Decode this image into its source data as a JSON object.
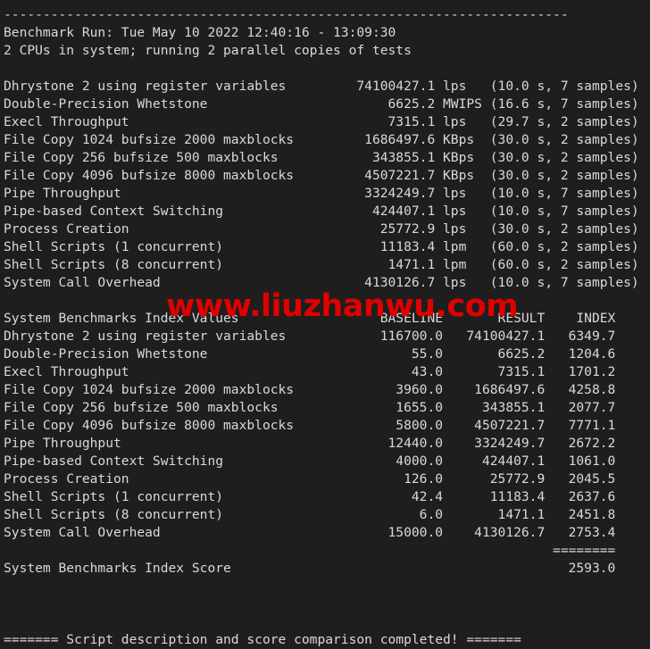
{
  "terminal": {
    "background_color": "#1e1e1e",
    "text_color": "#d9d9d9",
    "watermark_color": "#e00000",
    "top_rule": "------------------------------------------------------------------------",
    "header": {
      "benchmark_run_line": "Benchmark Run: Tue May 10 2022 12:40:16 - 13:09:30",
      "cpu_line": "2 CPUs in system; running 2 parallel copies of tests"
    },
    "raw_results": {
      "rows": [
        {
          "name": "Dhrystone 2 using register variables",
          "value": "74100427.1",
          "unit": "lps",
          "timing": "(10.0 s, 7 samples)"
        },
        {
          "name": "Double-Precision Whetstone",
          "value": "6625.2",
          "unit": "MWIPS",
          "timing": "(16.6 s, 7 samples)"
        },
        {
          "name": "Execl Throughput",
          "value": "7315.1",
          "unit": "lps",
          "timing": "(29.7 s, 2 samples)"
        },
        {
          "name": "File Copy 1024 bufsize 2000 maxblocks",
          "value": "1686497.6",
          "unit": "KBps",
          "timing": "(30.0 s, 2 samples)"
        },
        {
          "name": "File Copy 256 bufsize 500 maxblocks",
          "value": "343855.1",
          "unit": "KBps",
          "timing": "(30.0 s, 2 samples)"
        },
        {
          "name": "File Copy 4096 bufsize 8000 maxblocks",
          "value": "4507221.7",
          "unit": "KBps",
          "timing": "(30.0 s, 2 samples)"
        },
        {
          "name": "Pipe Throughput",
          "value": "3324249.7",
          "unit": "lps",
          "timing": "(10.0 s, 7 samples)"
        },
        {
          "name": "Pipe-based Context Switching",
          "value": "424407.1",
          "unit": "lps",
          "timing": "(10.0 s, 7 samples)"
        },
        {
          "name": "Process Creation",
          "value": "25772.9",
          "unit": "lps",
          "timing": "(30.0 s, 2 samples)"
        },
        {
          "name": "Shell Scripts (1 concurrent)",
          "value": "11183.4",
          "unit": "lpm",
          "timing": "(60.0 s, 2 samples)"
        },
        {
          "name": "Shell Scripts (8 concurrent)",
          "value": "1471.1",
          "unit": "lpm",
          "timing": "(60.0 s, 2 samples)"
        },
        {
          "name": "System Call Overhead",
          "value": "4130126.7",
          "unit": "lps",
          "timing": "(10.0 s, 7 samples)"
        }
      ]
    },
    "index_table": {
      "title": "System Benchmarks Index Values",
      "columns": [
        "BASELINE",
        "RESULT",
        "INDEX"
      ],
      "rows": [
        {
          "name": "Dhrystone 2 using register variables",
          "baseline": "116700.0",
          "result": "74100427.1",
          "index": "6349.7"
        },
        {
          "name": "Double-Precision Whetstone",
          "baseline": "55.0",
          "result": "6625.2",
          "index": "1204.6"
        },
        {
          "name": "Execl Throughput",
          "baseline": "43.0",
          "result": "7315.1",
          "index": "1701.2"
        },
        {
          "name": "File Copy 1024 bufsize 2000 maxblocks",
          "baseline": "3960.0",
          "result": "1686497.6",
          "index": "4258.8"
        },
        {
          "name": "File Copy 256 bufsize 500 maxblocks",
          "baseline": "1655.0",
          "result": "343855.1",
          "index": "2077.7"
        },
        {
          "name": "File Copy 4096 bufsize 8000 maxblocks",
          "baseline": "5800.0",
          "result": "4507221.7",
          "index": "7771.1"
        },
        {
          "name": "Pipe Throughput",
          "baseline": "12440.0",
          "result": "3324249.7",
          "index": "2672.2"
        },
        {
          "name": "Pipe-based Context Switching",
          "baseline": "4000.0",
          "result": "424407.1",
          "index": "1061.0"
        },
        {
          "name": "Process Creation",
          "baseline": "126.0",
          "result": "25772.9",
          "index": "2045.5"
        },
        {
          "name": "Shell Scripts (1 concurrent)",
          "baseline": "42.4",
          "result": "11183.4",
          "index": "2637.6"
        },
        {
          "name": "Shell Scripts (8 concurrent)",
          "baseline": "6.0",
          "result": "1471.1",
          "index": "2451.8"
        },
        {
          "name": "System Call Overhead",
          "baseline": "15000.0",
          "result": "4130126.7",
          "index": "2753.4"
        }
      ],
      "score_separator": "========",
      "score_label": "System Benchmarks Index Score",
      "score_value": "2593.0"
    },
    "footer": {
      "completion_line": "======= Script description and score comparison completed! ======="
    },
    "watermark": {
      "text": "www.liuzhanwu.com"
    }
  }
}
